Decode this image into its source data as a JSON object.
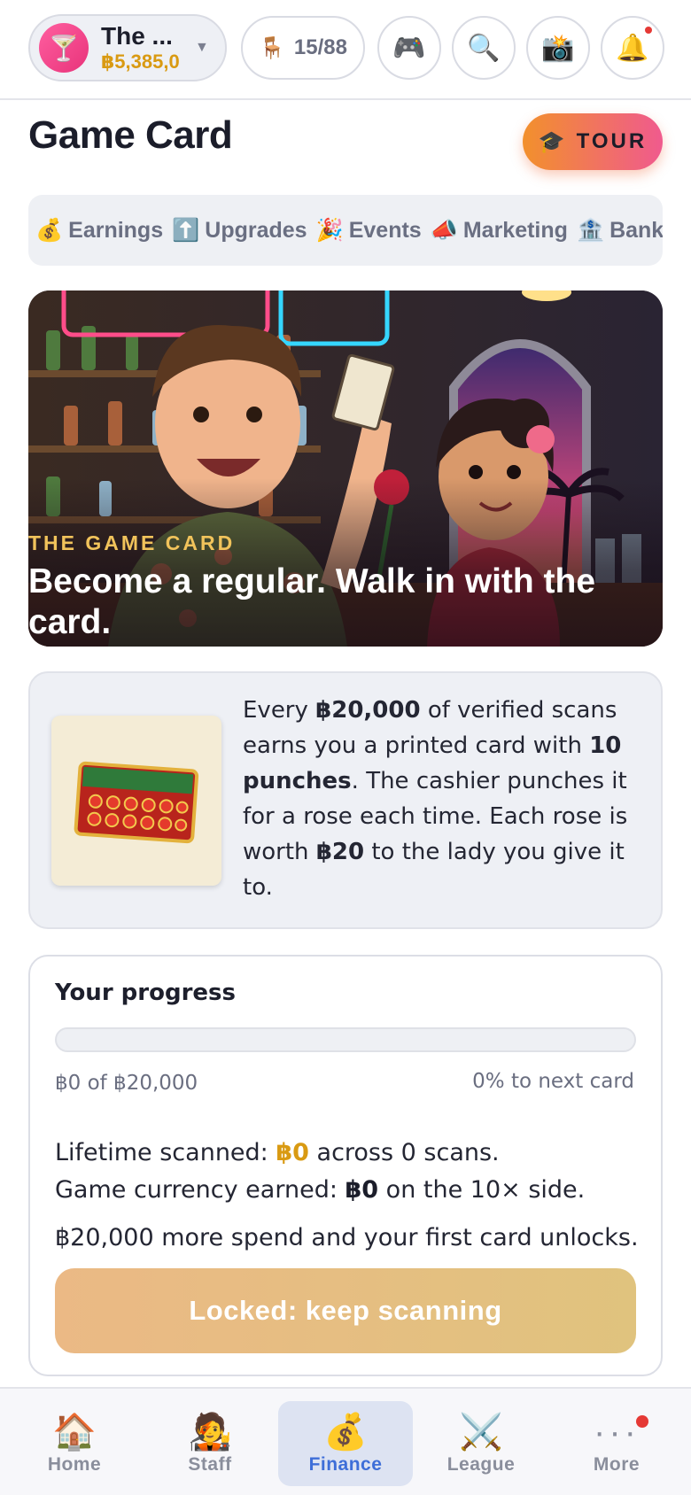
{
  "header": {
    "venue_name": "The ...",
    "venue_balance": "฿5,385,0",
    "venue_icon": "cocktail-glass-icon",
    "seats": "15/88",
    "buttons": [
      {
        "name": "games-button",
        "icon": "🎮"
      },
      {
        "name": "search-button",
        "icon": "🔍"
      },
      {
        "name": "camera-button",
        "icon": "📸"
      },
      {
        "name": "notifications-button",
        "icon": "🔔"
      }
    ]
  },
  "page": {
    "title": "Game Card",
    "tour_icon": "🎓",
    "tour_label": "TOUR"
  },
  "tabs": [
    {
      "icon": "💰",
      "label": "Earnings"
    },
    {
      "icon": "⬆️",
      "label": "Upgrades"
    },
    {
      "icon": "🎉",
      "label": "Events"
    },
    {
      "icon": "📣",
      "label": "Marketing"
    },
    {
      "icon": "🏦",
      "label": "Banking"
    }
  ],
  "hero": {
    "eyebrow": "THE GAME CARD",
    "headline": "Become a regular. Walk in with the card."
  },
  "info": {
    "p1": "Every ",
    "amount": "฿20,000",
    "p2": " of verified scans earns you a printed card with ",
    "punches": "10 punches",
    "p3": ". The cashier punches it for a rose each time. Each rose is worth ",
    "rose_value": "฿20",
    "p4": " to the lady you give it to."
  },
  "progress": {
    "title": "Your progress",
    "percent": 0,
    "amount_text": "฿0 of ฿20,000",
    "pct_text": "0% to next card",
    "lifetime_prefix": "Lifetime scanned: ",
    "lifetime_value": "฿0",
    "lifetime_suffix": " across 0 scans.",
    "currency_prefix": "Game currency earned: ",
    "currency_value": "฿0",
    "currency_suffix": " on the 10× side.",
    "remaining_text": "฿20,000 more spend and your first card unlocks.",
    "button_label": "Locked: keep scanning"
  },
  "bottom_nav": [
    {
      "icon": "🏠",
      "label": "Home",
      "active": false
    },
    {
      "icon": "🧑‍🎤",
      "label": "Staff",
      "active": false
    },
    {
      "icon": "💰",
      "label": "Finance",
      "active": true
    },
    {
      "icon": "⚔️",
      "label": "League",
      "active": false
    },
    {
      "icon": "···",
      "label": "More",
      "active": false
    }
  ],
  "colors": {
    "accent_gold": "#d99a12",
    "active_blue": "#3e6ed8",
    "tour_gradient_start": "#f2902c",
    "tour_gradient_end": "#f05a8e",
    "locked_button": "#e6bd82"
  }
}
